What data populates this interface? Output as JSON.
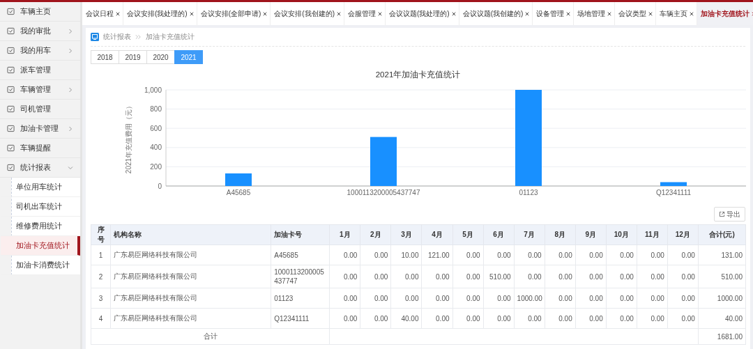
{
  "sidebar": {
    "items": [
      {
        "label": "车辆主页"
      },
      {
        "label": "我的审批",
        "expanded": false
      },
      {
        "label": "我的用车",
        "expanded": false
      },
      {
        "label": "派车管理"
      },
      {
        "label": "车辆管理",
        "expanded": false
      },
      {
        "label": "司机管理"
      },
      {
        "label": "加油卡管理",
        "expanded": false
      },
      {
        "label": "车辆提醒"
      },
      {
        "label": "统计报表",
        "expanded": true,
        "children": [
          {
            "label": "单位用车统计",
            "selected": false
          },
          {
            "label": "司机出车统计",
            "selected": false
          },
          {
            "label": "维修费用统计",
            "selected": false
          },
          {
            "label": "加油卡充值统计",
            "selected": true
          },
          {
            "label": "加油卡消费统计",
            "selected": false
          }
        ]
      }
    ]
  },
  "tabs": [
    {
      "label": "会议日程",
      "selected": false
    },
    {
      "label": "会议安排(我处理的)",
      "selected": false
    },
    {
      "label": "会议安排(全部申请)",
      "selected": false
    },
    {
      "label": "会议安排(我创建的)",
      "selected": false
    },
    {
      "label": "会服管理",
      "selected": false
    },
    {
      "label": "会议议题(我处理的)",
      "selected": false
    },
    {
      "label": "会议议题(我创建的)",
      "selected": false
    },
    {
      "label": "设备管理",
      "selected": false
    },
    {
      "label": "场地管理",
      "selected": false
    },
    {
      "label": "会议类型",
      "selected": false
    },
    {
      "label": "车辆主页",
      "selected": false
    },
    {
      "label": "加油卡充值统计",
      "selected": true
    }
  ],
  "breadcrumb": [
    "统计报表",
    "加油卡充值统计"
  ],
  "years": [
    {
      "label": "2018",
      "selected": false
    },
    {
      "label": "2019",
      "selected": false
    },
    {
      "label": "2020",
      "selected": false
    },
    {
      "label": "2021",
      "selected": true
    }
  ],
  "chart_data": {
    "type": "bar",
    "title": "2021年加油卡充值统计",
    "ylabel": "2021年充值费用（元）",
    "categories": [
      "A45685",
      "1000113200005437747",
      "01123",
      "Q12341111"
    ],
    "values": [
      131,
      510,
      1000,
      40
    ],
    "grid": true,
    "ylim": [
      0,
      1000
    ],
    "yticks": [
      0,
      200,
      400,
      600,
      800,
      {
        "value": 1000,
        "label": "1,000"
      }
    ]
  },
  "export_button": "导出",
  "table": {
    "columns": [
      "序号",
      "机构名称",
      "加油卡号",
      "1月",
      "2月",
      "3月",
      "4月",
      "5月",
      "6月",
      "7月",
      "8月",
      "9月",
      "10月",
      "11月",
      "12月",
      "合计(元)"
    ],
    "rows": [
      [
        "1",
        "广东易臣网络科技有限公司",
        "A45685",
        "0.00",
        "0.00",
        "10.00",
        "121.00",
        "0.00",
        "0.00",
        "0.00",
        "0.00",
        "0.00",
        "0.00",
        "0.00",
        "0.00",
        "131.00"
      ],
      [
        "2",
        "广东易臣网络科技有限公司",
        "1000113200005437747",
        "0.00",
        "0.00",
        "0.00",
        "0.00",
        "0.00",
        "510.00",
        "0.00",
        "0.00",
        "0.00",
        "0.00",
        "0.00",
        "0.00",
        "510.00"
      ],
      [
        "3",
        "广东易臣网络科技有限公司",
        "01123",
        "0.00",
        "0.00",
        "0.00",
        "0.00",
        "0.00",
        "0.00",
        "1000.00",
        "0.00",
        "0.00",
        "0.00",
        "0.00",
        "0.00",
        "1000.00"
      ],
      [
        "4",
        "广东易臣网络科技有限公司",
        "Q12341111",
        "0.00",
        "0.00",
        "40.00",
        "0.00",
        "0.00",
        "0.00",
        "0.00",
        "0.00",
        "0.00",
        "0.00",
        "0.00",
        "0.00",
        "40.00"
      ]
    ],
    "total": {
      "label": "合计",
      "value": "1681.00"
    }
  }
}
